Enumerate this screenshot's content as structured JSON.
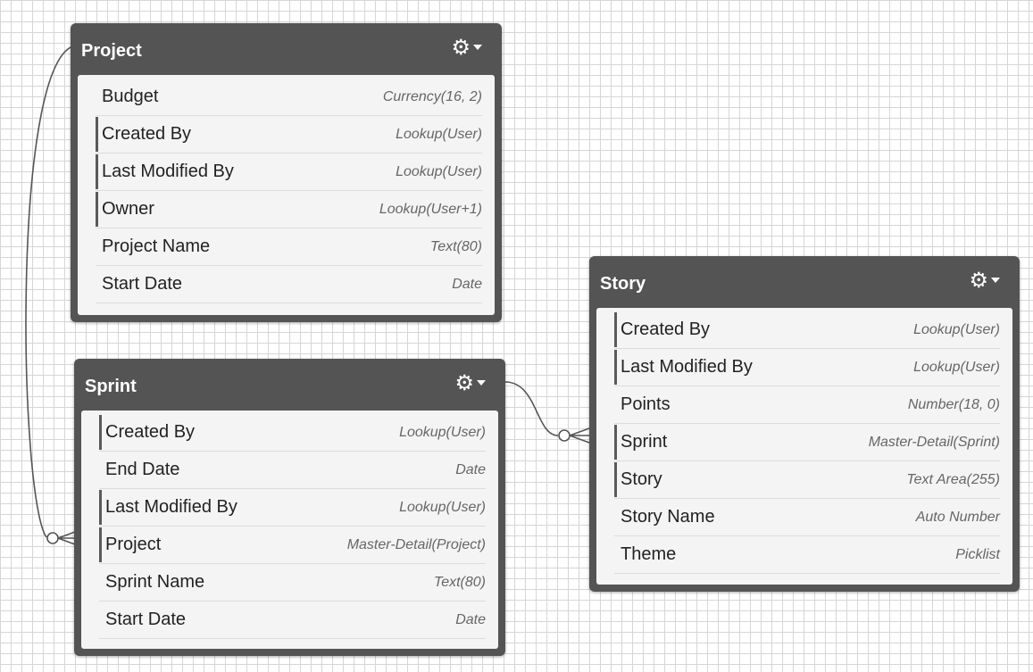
{
  "objects": {
    "project": {
      "title": "Project",
      "fields": [
        {
          "name": "Budget",
          "type": "Currency(16, 2)",
          "relationship": false
        },
        {
          "name": "Created By",
          "type": "Lookup(User)",
          "relationship": true
        },
        {
          "name": "Last Modified By",
          "type": "Lookup(User)",
          "relationship": true
        },
        {
          "name": "Owner",
          "type": "Lookup(User+1)",
          "relationship": true
        },
        {
          "name": "Project Name",
          "type": "Text(80)",
          "relationship": false
        },
        {
          "name": "Start Date",
          "type": "Date",
          "relationship": false
        }
      ]
    },
    "sprint": {
      "title": "Sprint",
      "fields": [
        {
          "name": "Created By",
          "type": "Lookup(User)",
          "relationship": true
        },
        {
          "name": "End Date",
          "type": "Date",
          "relationship": false
        },
        {
          "name": "Last Modified By",
          "type": "Lookup(User)",
          "relationship": true
        },
        {
          "name": "Project",
          "type": "Master-Detail(Project)",
          "relationship": true
        },
        {
          "name": "Sprint Name",
          "type": "Text(80)",
          "relationship": false
        },
        {
          "name": "Start Date",
          "type": "Date",
          "relationship": false
        }
      ]
    },
    "story": {
      "title": "Story",
      "fields": [
        {
          "name": "Created By",
          "type": "Lookup(User)",
          "relationship": true
        },
        {
          "name": "Last Modified By",
          "type": "Lookup(User)",
          "relationship": true
        },
        {
          "name": "Points",
          "type": "Number(18, 0)",
          "relationship": false
        },
        {
          "name": "Sprint",
          "type": "Master-Detail(Sprint)",
          "relationship": true
        },
        {
          "name": "Story",
          "type": "Text Area(255)",
          "relationship": true
        },
        {
          "name": "Story Name",
          "type": "Auto Number",
          "relationship": false
        },
        {
          "name": "Theme",
          "type": "Picklist",
          "relationship": false
        }
      ]
    }
  },
  "icons": {
    "menu": "gear-icon",
    "caret": "chevron-down-icon",
    "relationship_end": "crows-foot-icon"
  }
}
